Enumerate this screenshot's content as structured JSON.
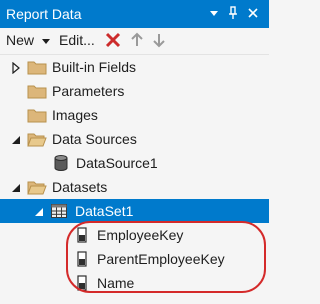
{
  "window": {
    "title": "Report Data",
    "accent_color": "#007acc",
    "controls": [
      "dropdown-icon",
      "pin-icon",
      "close-icon"
    ]
  },
  "toolbar": {
    "new_label": "New",
    "edit_label": "Edit...",
    "delete_icon": "delete-x-icon",
    "move_up_icon": "arrow-up-icon",
    "move_down_icon": "arrow-down-icon"
  },
  "tree": {
    "items": [
      {
        "label": "Built-in Fields",
        "icon": "folder-icon",
        "expander": "collapsed"
      },
      {
        "label": "Parameters",
        "icon": "folder-icon",
        "expander": "none"
      },
      {
        "label": "Images",
        "icon": "folder-icon",
        "expander": "none"
      },
      {
        "label": "Data Sources",
        "icon": "folder-icon",
        "expander": "expanded"
      },
      {
        "label": "DataSource1",
        "icon": "database-icon",
        "expander": "none"
      },
      {
        "label": "Datasets",
        "icon": "folder-icon",
        "expander": "expanded"
      },
      {
        "label": "DataSet1",
        "icon": "table-icon",
        "expander": "expanded",
        "selected": true
      },
      {
        "label": "EmployeeKey",
        "icon": "field-icon",
        "expander": "none"
      },
      {
        "label": "ParentEmployeeKey",
        "icon": "field-icon",
        "expander": "none"
      },
      {
        "label": "Name",
        "icon": "field-icon",
        "expander": "none"
      }
    ]
  },
  "annotation": {
    "color": "#d42a2a"
  }
}
